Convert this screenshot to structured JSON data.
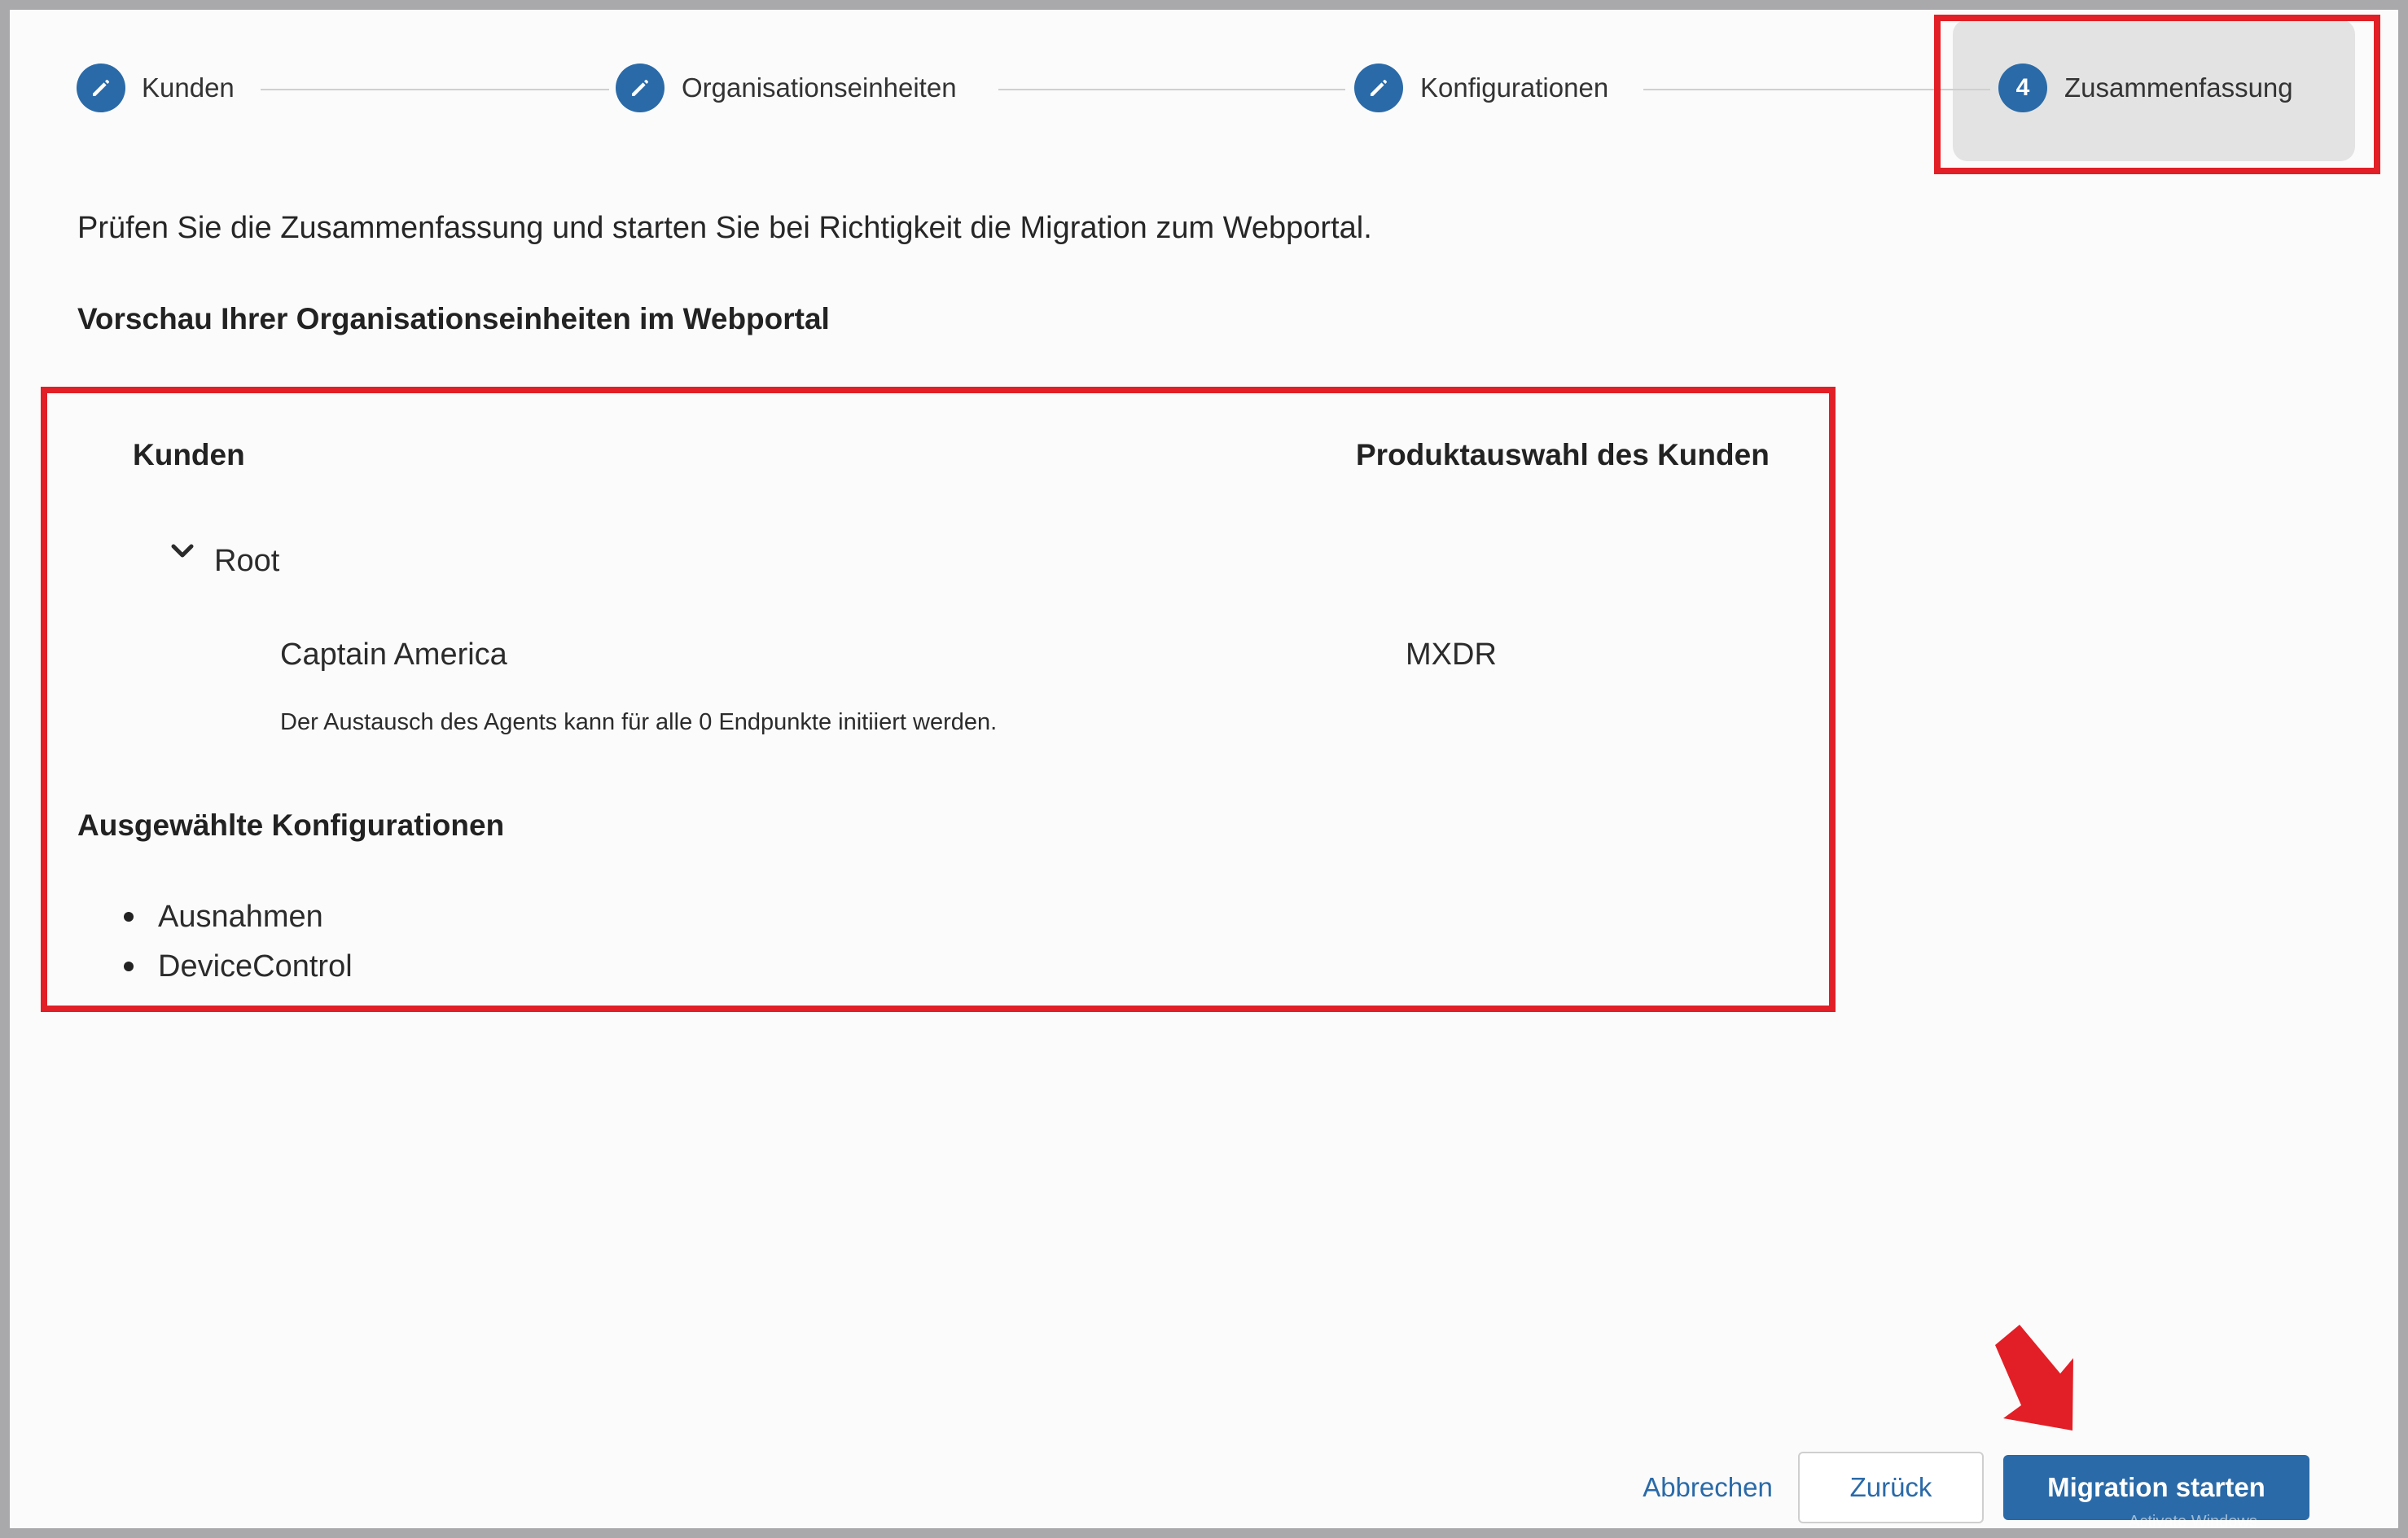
{
  "stepper": {
    "steps": [
      {
        "label": "Kunden",
        "state": "completed",
        "icon": "pencil-icon"
      },
      {
        "label": "Organisationseinheiten",
        "state": "completed",
        "icon": "pencil-icon"
      },
      {
        "label": "Konfigurationen",
        "state": "completed",
        "icon": "pencil-icon"
      },
      {
        "label": "Zusammenfassung",
        "state": "active",
        "number": "4"
      }
    ]
  },
  "intro_text": "Prüfen Sie die Zusammenfassung und starten Sie bei Richtigkeit die Migration zum Webportal.",
  "preview": {
    "heading": "Vorschau Ihrer Organisationseinheiten im Webportal",
    "columns": {
      "customers": "Kunden",
      "product": "Produktauswahl des Kunden"
    },
    "tree": {
      "root_label": "Root",
      "root_icon": "chevron-down-icon",
      "children": [
        {
          "name": "Captain America",
          "product": "MXDR",
          "note": "Der Austausch des Agents kann für alle 0 Endpunkte initiiert werden."
        }
      ]
    }
  },
  "configurations": {
    "heading": "Ausgewählte Konfigurationen",
    "items": [
      "Ausnahmen",
      "DeviceControl"
    ]
  },
  "footer": {
    "cancel_label": "Abbrechen",
    "back_label": "Zurück",
    "start_label": "Migration starten"
  },
  "watermark": "Activate Windows",
  "colors": {
    "accent": "#2a6aa8",
    "annotation": "#e21f26"
  }
}
